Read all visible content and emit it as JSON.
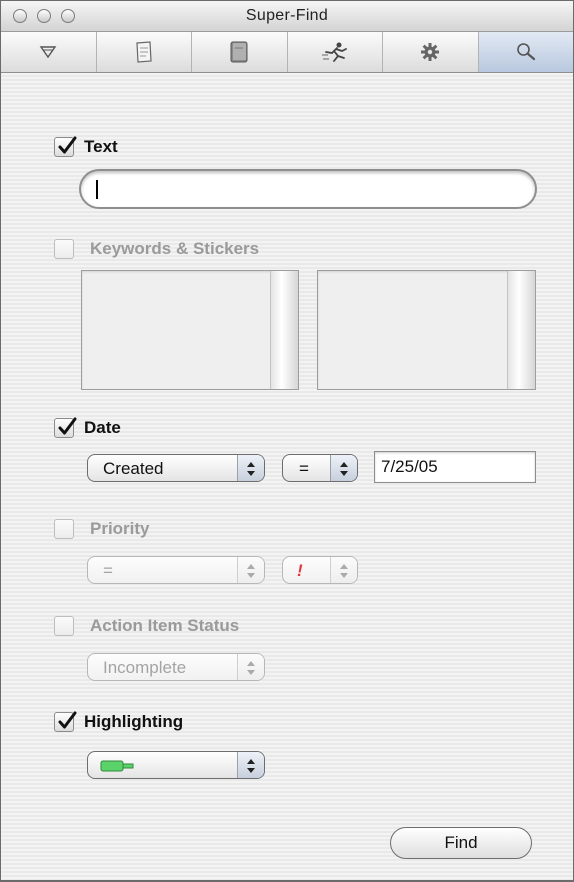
{
  "window": {
    "title": "Super-Find"
  },
  "toolbar": {
    "tabs": [
      {
        "icon": "funnel-icon"
      },
      {
        "icon": "note-icon"
      },
      {
        "icon": "notebook-icon"
      },
      {
        "icon": "runner-icon"
      },
      {
        "icon": "gear-icon"
      },
      {
        "icon": "search-icon",
        "selected": true
      }
    ]
  },
  "text_section": {
    "label": "Text",
    "checked": true,
    "value": ""
  },
  "keywords_section": {
    "label": "Keywords & Stickers",
    "checked": false
  },
  "date_section": {
    "label": "Date",
    "checked": true,
    "field_popup": "Created",
    "operator_popup": "=",
    "date_value": "7/25/05"
  },
  "priority_section": {
    "label": "Priority",
    "checked": false,
    "operator_popup": "=",
    "priority_popup": "!"
  },
  "action_section": {
    "label": "Action Item Status",
    "checked": false,
    "status_popup": "Incomplete"
  },
  "highlight_section": {
    "label": "Highlighting",
    "checked": true,
    "color": "#5bd36a"
  },
  "find_button": {
    "label": "Find"
  },
  "colors": {
    "selected_tab": "#c6d3e6",
    "priority_mark": "#e23a3a"
  }
}
